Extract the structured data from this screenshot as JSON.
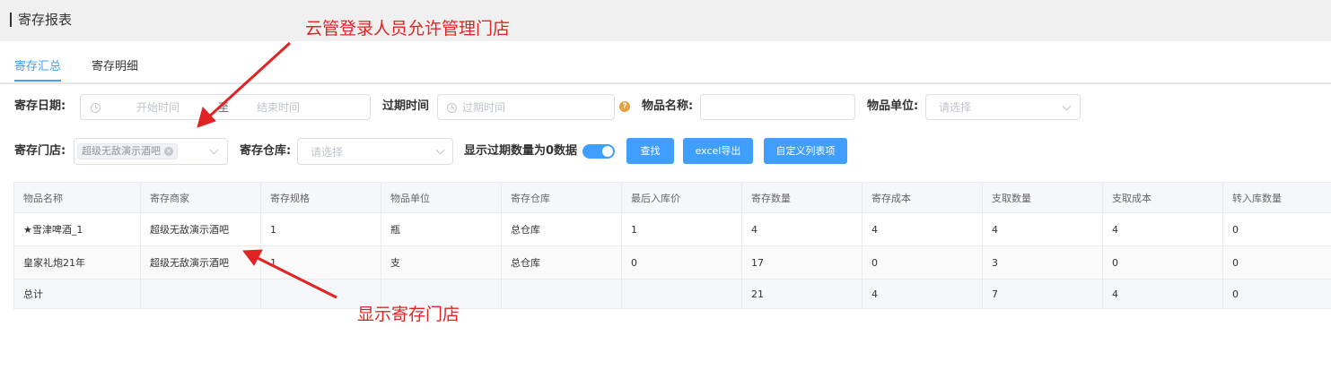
{
  "page": {
    "title": "寄存报表"
  },
  "tabs": [
    {
      "label": "寄存汇总",
      "active": true
    },
    {
      "label": "寄存明细",
      "active": false
    }
  ],
  "filters": {
    "date_label": "寄存日期:",
    "start_placeholder": "开始时间",
    "end_placeholder": "结束时间",
    "range_separator": "至",
    "expire_label": "过期时间",
    "expire_placeholder": "过期时间",
    "item_name_label": "物品名称:",
    "item_name_value": "",
    "item_unit_label": "物品单位:",
    "item_unit_placeholder": "请选择",
    "store_label": "寄存门店:",
    "store_tag": "超级无敌演示酒吧",
    "warehouse_label": "寄存仓库:",
    "warehouse_placeholder": "请选择",
    "show_expired_label": "显示过期数量为0数据",
    "show_expired_on": true
  },
  "buttons": {
    "search": "查找",
    "export": "excel导出",
    "custom_columns": "自定义列表项"
  },
  "table": {
    "columns": [
      "物品名称",
      "寄存商家",
      "寄存规格",
      "物品单位",
      "寄存仓库",
      "最后入库价",
      "寄存数量",
      "寄存成本",
      "支取数量",
      "支取成本",
      "转入库数量"
    ],
    "rows": [
      [
        "★雪津啤酒_1",
        "超级无敌演示酒吧",
        "1",
        "瓶",
        "总仓库",
        "1",
        "4",
        "4",
        "4",
        "4",
        "0"
      ],
      [
        "皇家礼炮21年",
        "超级无敌演示酒吧",
        "1",
        "支",
        "总仓库",
        "0",
        "17",
        "0",
        "3",
        "0",
        "0"
      ]
    ],
    "total": [
      "总计",
      "",
      "",
      "",
      "",
      "",
      "21",
      "4",
      "7",
      "4",
      "0"
    ]
  },
  "annotations": {
    "top": "云管登录人员允许管理门店",
    "bottom": "显示寄存门店"
  },
  "colors": {
    "accent": "#409eff",
    "annotation": "#e02424",
    "help_icon": "#e6a23c"
  },
  "icons": {
    "date": "clock-icon",
    "help": "question-icon",
    "select": "chevron-down-icon",
    "tag_close": "close-icon"
  }
}
